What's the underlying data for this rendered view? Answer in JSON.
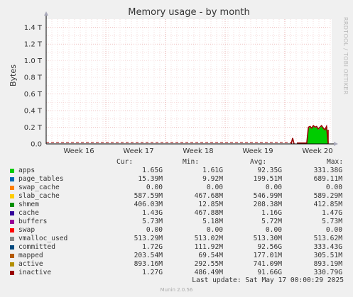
{
  "chart_data": {
    "type": "area",
    "title": "Memory usage - by month",
    "ylabel": "Bytes",
    "ylim": [
      0,
      1.5
    ],
    "y_unit": "T",
    "y_ticks": [
      "0.0",
      "0.2 T",
      "0.4 T",
      "0.6 T",
      "0.8 T",
      "1.0 T",
      "1.2 T",
      "1.4 T"
    ],
    "y_tick_values": [
      0,
      0.2,
      0.4,
      0.6,
      0.8,
      1.0,
      1.2,
      1.4
    ],
    "x_ticks": [
      "Week 16",
      "Week 17",
      "Week 18",
      "Week 19",
      "Week 20"
    ],
    "grid": true,
    "series_sample": {
      "apps_T": [
        0,
        0,
        0,
        0,
        0,
        0,
        0,
        0.19,
        0.2,
        0.18,
        0.21,
        0.19,
        0.2,
        0.17,
        0.19,
        0.21,
        0.18,
        0.16,
        0.2,
        0.0
      ]
    }
  },
  "side_text": "RRDTOOL / TOBI OETIKER",
  "legend_header": {
    "cur": "Cur:",
    "min": "Min:",
    "avg": "Avg:",
    "max": "Max:"
  },
  "legend": [
    {
      "name": "apps",
      "color": "#00cc00",
      "cur": "1.65G",
      "min": "1.61G",
      "avg": "92.35G",
      "max": "331.38G"
    },
    {
      "name": "page_tables",
      "color": "#0066b3",
      "cur": "15.39M",
      "min": "9.92M",
      "avg": "199.51M",
      "max": "689.11M"
    },
    {
      "name": "swap_cache",
      "color": "#ff8000",
      "cur": "0.00",
      "min": "0.00",
      "avg": "0.00",
      "max": "0.00"
    },
    {
      "name": "slab_cache",
      "color": "#ffcc00",
      "cur": "587.59M",
      "min": "467.68M",
      "avg": "546.99M",
      "max": "589.29M"
    },
    {
      "name": "shmem",
      "color": "#008f00",
      "cur": "406.03M",
      "min": "12.85M",
      "avg": "208.38M",
      "max": "412.85M"
    },
    {
      "name": "cache",
      "color": "#330099",
      "cur": "1.43G",
      "min": "467.88M",
      "avg": "1.16G",
      "max": "1.47G"
    },
    {
      "name": "buffers",
      "color": "#990099",
      "cur": "5.73M",
      "min": "5.18M",
      "avg": "5.72M",
      "max": "5.73M"
    },
    {
      "name": "swap",
      "color": "#ff0000",
      "cur": "0.00",
      "min": "0.00",
      "avg": "0.00",
      "max": "0.00"
    },
    {
      "name": "vmalloc_used",
      "color": "#888888",
      "cur": "513.29M",
      "min": "513.02M",
      "avg": "513.30M",
      "max": "513.62M"
    },
    {
      "name": "committed",
      "color": "#00487d",
      "cur": "1.72G",
      "min": "111.92M",
      "avg": "92.56G",
      "max": "333.43G"
    },
    {
      "name": "mapped",
      "color": "#b35a00",
      "cur": "203.54M",
      "min": "69.54M",
      "avg": "177.01M",
      "max": "305.51M"
    },
    {
      "name": "active",
      "color": "#b38f00",
      "cur": "893.16M",
      "min": "292.55M",
      "avg": "741.09M",
      "max": "893.19M"
    },
    {
      "name": "inactive",
      "color": "#990000",
      "cur": "1.27G",
      "min": "486.49M",
      "avg": "91.66G",
      "max": "330.79G"
    }
  ],
  "last_update": "Last update: Sat May 17 00:00:29 2025",
  "version": "Munin 2.0.56"
}
